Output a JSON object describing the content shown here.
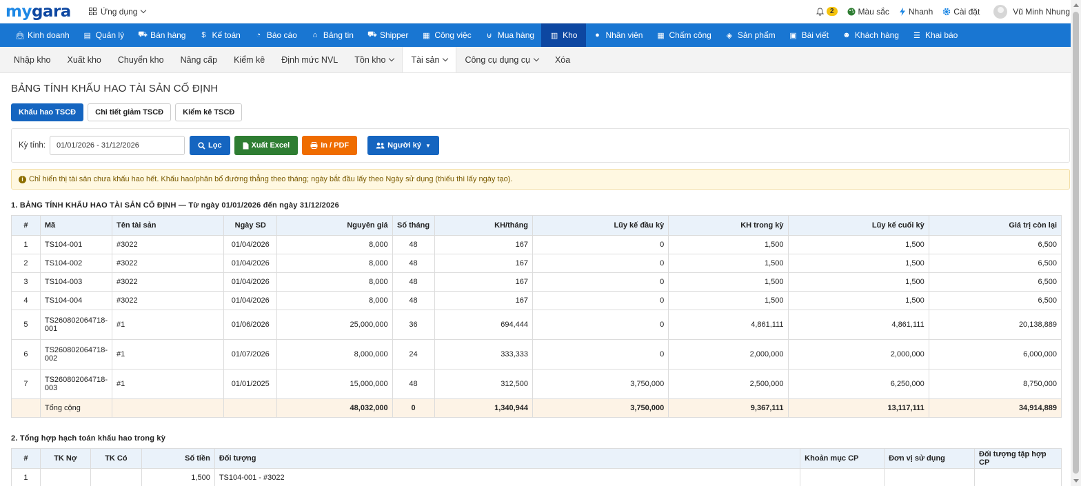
{
  "brand": {
    "my": "my",
    "gara": "gara"
  },
  "topbar": {
    "apps_label": "Ứng dụng",
    "notif_count": "2",
    "color_label": "Màu sắc",
    "quick_label": "Nhanh",
    "settings_label": "Cài đặt",
    "user_name": "Vũ Minh Nhung"
  },
  "mainnav": [
    {
      "label": "Kinh doanh",
      "icon": "bag-icon"
    },
    {
      "label": "Quản lý",
      "icon": "id-card-icon"
    },
    {
      "label": "Bán hàng",
      "icon": "cart-icon"
    },
    {
      "label": "Kế toán",
      "icon": "dollar-icon"
    },
    {
      "label": "Báo cáo",
      "icon": "pie-chart-icon"
    },
    {
      "label": "Bảng tin",
      "icon": "home-icon"
    },
    {
      "label": "Shipper",
      "icon": "truck-icon"
    },
    {
      "label": "Công việc",
      "icon": "calendar-icon"
    },
    {
      "label": "Mua hàng",
      "icon": "basket-icon"
    },
    {
      "label": "Kho",
      "icon": "warehouse-icon"
    },
    {
      "label": "Nhân viên",
      "icon": "user-icon"
    },
    {
      "label": "Chấm công",
      "icon": "calendar-check-icon"
    },
    {
      "label": "Sản phẩm",
      "icon": "cube-icon"
    },
    {
      "label": "Bài viết",
      "icon": "book-icon"
    },
    {
      "label": "Khách hàng",
      "icon": "smile-icon"
    },
    {
      "label": "Khai báo",
      "icon": "list-icon"
    }
  ],
  "subnav": [
    {
      "label": "Nhập kho"
    },
    {
      "label": "Xuất kho"
    },
    {
      "label": "Chuyển kho"
    },
    {
      "label": "Nâng cấp"
    },
    {
      "label": "Kiểm kê"
    },
    {
      "label": "Định mức NVL"
    },
    {
      "label": "Tồn kho"
    },
    {
      "label": "Tài sản"
    },
    {
      "label": "Công cụ dụng cụ"
    },
    {
      "label": "Xóa"
    }
  ],
  "page": {
    "title": "BẢNG TÍNH KHẤU HAO TÀI SẢN CỐ ĐỊNH",
    "tabs": [
      "Khấu hao TSCĐ",
      "Chi tiết giảm TSCĐ",
      "Kiểm kê TSCĐ"
    ],
    "filter": {
      "label": "Kỳ tính:",
      "date_range": "01/01/2026 - 31/12/2026",
      "filter_btn": "Lọc",
      "excel_btn": "Xuất Excel",
      "pdf_btn": "In / PDF",
      "signer_btn": "Người ký"
    },
    "notice": "Chỉ hiển thị tài sản chưa khấu hao hết. Khấu hao/phân bổ đường thẳng theo tháng; ngày bắt đầu lấy theo Ngày sử dụng (thiếu thì lấy ngày tạo)."
  },
  "table1": {
    "title": "1. BẢNG TÍNH KHẤU HAO TÀI SẢN CỐ ĐỊNH — Từ ngày 01/01/2026 đến ngày 31/12/2026",
    "headers": [
      "#",
      "Mã",
      "Tên tài sản",
      "Ngày SD",
      "Nguyên giá",
      "Số tháng",
      "KH/tháng",
      "Lũy kế đầu kỳ",
      "KH trong kỳ",
      "Lũy kế cuối kỳ",
      "Giá trị còn lại"
    ],
    "rows": [
      {
        "n": "1",
        "code": "TS104-001",
        "name": "#3022",
        "date": "01/04/2026",
        "cost": "8,000",
        "months": "48",
        "monthly": "167",
        "open": "0",
        "period": "1,500",
        "close": "1,500",
        "remain": "6,500"
      },
      {
        "n": "2",
        "code": "TS104-002",
        "name": "#3022",
        "date": "01/04/2026",
        "cost": "8,000",
        "months": "48",
        "monthly": "167",
        "open": "0",
        "period": "1,500",
        "close": "1,500",
        "remain": "6,500"
      },
      {
        "n": "3",
        "code": "TS104-003",
        "name": "#3022",
        "date": "01/04/2026",
        "cost": "8,000",
        "months": "48",
        "monthly": "167",
        "open": "0",
        "period": "1,500",
        "close": "1,500",
        "remain": "6,500"
      },
      {
        "n": "4",
        "code": "TS104-004",
        "name": "#3022",
        "date": "01/04/2026",
        "cost": "8,000",
        "months": "48",
        "monthly": "167",
        "open": "0",
        "period": "1,500",
        "close": "1,500",
        "remain": "6,500"
      },
      {
        "n": "5",
        "code1": "TS260802064718-",
        "code2": "001",
        "name": "#1",
        "date": "01/06/2026",
        "cost": "25,000,000",
        "months": "36",
        "monthly": "694,444",
        "open": "0",
        "period": "4,861,111",
        "close": "4,861,111",
        "remain": "20,138,889"
      },
      {
        "n": "6",
        "code1": "TS260802064718-",
        "code2": "002",
        "name": "#1",
        "date": "01/07/2026",
        "cost": "8,000,000",
        "months": "24",
        "monthly": "333,333",
        "open": "0",
        "period": "2,000,000",
        "close": "2,000,000",
        "remain": "6,000,000"
      },
      {
        "n": "7",
        "code1": "TS260802064718-",
        "code2": "003",
        "name": "#1",
        "date": "01/01/2025",
        "cost": "15,000,000",
        "months": "48",
        "monthly": "312,500",
        "open": "3,750,000",
        "period": "2,500,000",
        "close": "6,250,000",
        "remain": "8,750,000"
      }
    ],
    "total": {
      "label": "Tổng cộng",
      "cost": "48,032,000",
      "months": "0",
      "monthly": "1,340,944",
      "open": "3,750,000",
      "period": "9,367,111",
      "close": "13,117,111",
      "remain": "34,914,889"
    }
  },
  "table2": {
    "title": "2. Tổng hợp hạch toán khấu hao trong kỳ",
    "headers": [
      "#",
      "TK Nợ",
      "TK Có",
      "Số tiền",
      "Đối tượng",
      "Khoản mục CP",
      "Đơn vị sử dụng",
      "Đối tượng tập hợp CP"
    ],
    "rows": [
      {
        "n": "1",
        "debit": "",
        "credit": "",
        "amount": "1,500",
        "object": "TS104-001 - #3022",
        "expense": "",
        "unit": "",
        "cost_obj": ""
      }
    ]
  }
}
